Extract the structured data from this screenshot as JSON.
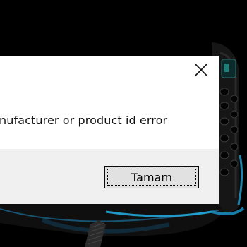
{
  "dialog": {
    "message": "nufacturer or product id error",
    "ok_label": "Tamam",
    "close_icon": "close-icon"
  },
  "colors": {
    "desktop_background": "#000000",
    "dialog_body": "#ffffff",
    "dialog_footer": "#f0f0f0",
    "button_face": "#e1e1e1",
    "mouse_accent": "#22a6d8"
  }
}
